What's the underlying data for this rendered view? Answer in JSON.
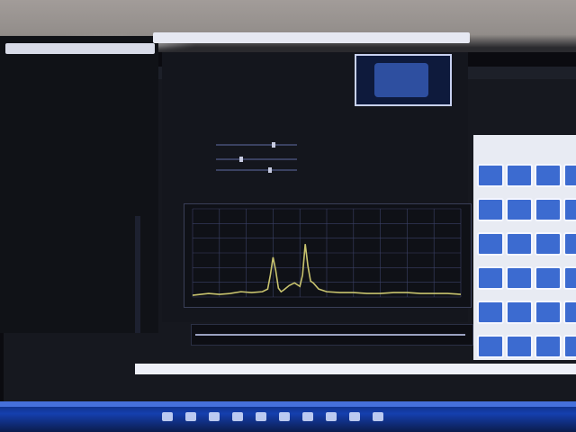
{
  "window": {
    "title": "",
    "status_text": ""
  },
  "left_panel": {
    "lines": "",
    "tree_items": [
      "",
      "",
      "",
      "",
      "",
      "",
      "",
      "",
      "",
      "",
      "",
      "",
      ""
    ]
  },
  "parameters": {
    "rows": [
      {
        "label": "",
        "value": ""
      },
      {
        "label": "",
        "value": ""
      },
      {
        "label": "",
        "value": ""
      },
      {
        "label": "",
        "value": ""
      },
      {
        "label": "",
        "value": ""
      },
      {
        "label": "",
        "value": ""
      }
    ]
  },
  "tabs": [
    "",
    "",
    ""
  ],
  "taskbar": {
    "start_label": ""
  },
  "colors": {
    "plot_line": "#c8c36e",
    "plot_grid": "#3b4166",
    "accent": "#2e4fa0"
  },
  "icons": [
    "app-icon",
    "gallery-thumbnail",
    "taskbar-icon"
  ],
  "chart_data": {
    "type": "line",
    "title": "",
    "xlabel": "",
    "ylabel": "",
    "xlim": [
      0,
      100
    ],
    "ylim": [
      0,
      10
    ],
    "grid": true,
    "series": [
      {
        "values": [
          [
            0,
            0.2
          ],
          [
            3,
            0.3
          ],
          [
            6,
            0.4
          ],
          [
            10,
            0.3
          ],
          [
            14,
            0.4
          ],
          [
            18,
            0.6
          ],
          [
            22,
            0.5
          ],
          [
            26,
            0.6
          ],
          [
            28,
            0.9
          ],
          [
            29,
            2.5
          ],
          [
            30,
            4.5
          ],
          [
            31,
            3.0
          ],
          [
            32,
            1.0
          ],
          [
            33,
            0.6
          ],
          [
            34,
            0.8
          ],
          [
            36,
            1.3
          ],
          [
            38,
            1.6
          ],
          [
            40,
            1.2
          ],
          [
            41,
            2.5
          ],
          [
            42,
            6.0
          ],
          [
            43,
            3.5
          ],
          [
            44,
            1.8
          ],
          [
            45,
            1.6
          ],
          [
            47,
            0.9
          ],
          [
            50,
            0.6
          ],
          [
            55,
            0.5
          ],
          [
            60,
            0.5
          ],
          [
            65,
            0.4
          ],
          [
            70,
            0.4
          ],
          [
            75,
            0.5
          ],
          [
            80,
            0.5
          ],
          [
            85,
            0.4
          ],
          [
            90,
            0.4
          ],
          [
            95,
            0.4
          ],
          [
            100,
            0.3
          ]
        ]
      }
    ]
  }
}
